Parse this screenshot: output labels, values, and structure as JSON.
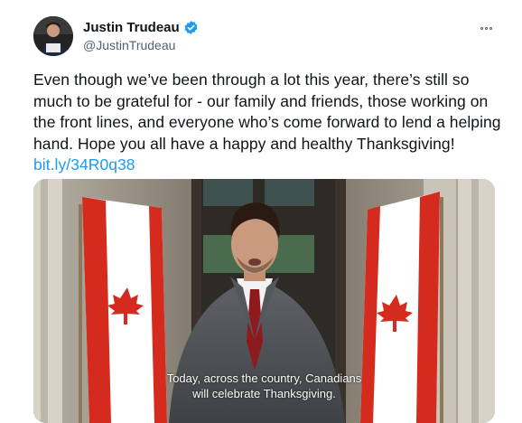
{
  "author": {
    "display_name": "Justin Trudeau",
    "handle": "@JustinTrudeau",
    "verified": true,
    "avatar_label_line1": "Justin",
    "avatar_label_line2": "Trudeau"
  },
  "tweet": {
    "text_lines": [
      "Even though we’ve been through a lot this year, there’s still so",
      "much to be grateful for - our family and friends, those working on",
      "the front lines, and everyone who’s come forward to lend a helping",
      "hand. Hope you all have a happy and healthy Thanksgiving!"
    ],
    "link_text": "bit.ly/34R0q38"
  },
  "media": {
    "caption_line1": "Today, across the country, Canadians",
    "caption_line2": "will celebrate Thanksgiving."
  },
  "colors": {
    "accent": "#1d9bf0",
    "flag_red": "#d52b1e",
    "text_secondary": "#536471"
  },
  "icons": {
    "verified": "verified-badge-icon",
    "more": "more-options-icon"
  }
}
